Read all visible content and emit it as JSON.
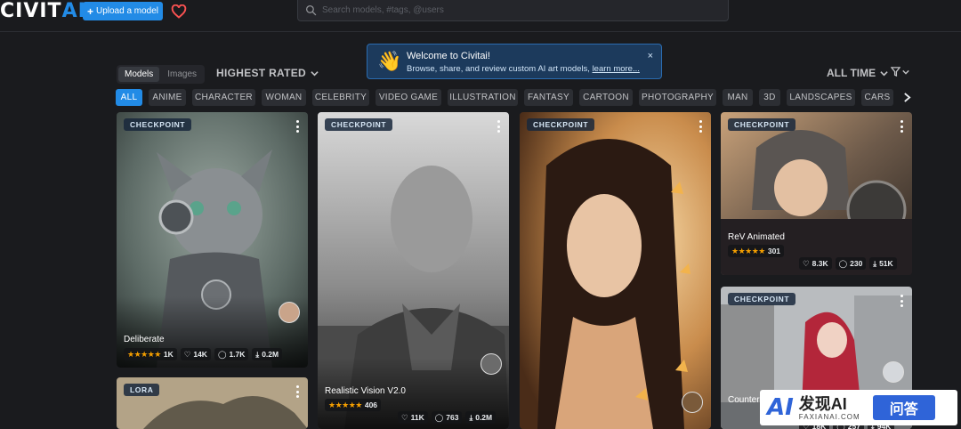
{
  "header": {
    "logo_part1": "CIVIT",
    "logo_part2": "AI",
    "upload_label": "Upload a model",
    "search_placeholder": "Search models, #tags, @users"
  },
  "toast": {
    "title": "Welcome to Civitai!",
    "body": "Browse, share, and review custom AI art models, ",
    "link": "learn more...",
    "close": "×"
  },
  "toolbar": {
    "tab_models": "Models",
    "tab_images": "Images",
    "sort": "HIGHEST RATED",
    "period": "ALL TIME"
  },
  "chips": [
    "ALL",
    "ANIME",
    "CHARACTER",
    "WOMAN",
    "CELEBRITY",
    "VIDEO GAME",
    "ILLUSTRATION",
    "FANTASY",
    "CARTOON",
    "PHOTOGRAPHY",
    "MAN",
    "3D",
    "LANDSCAPES",
    "CARS"
  ],
  "cards": [
    {
      "badge": "CHECKPOINT",
      "title": "Deliberate",
      "reviews": "1K",
      "likes": "14K",
      "comments": "1.7K",
      "downloads": "0.2M"
    },
    {
      "badge": "CHECKPOINT",
      "title": "Realistic Vision V2.0",
      "reviews": "406",
      "likes": "11K",
      "comments": "763",
      "downloads": "0.2M"
    },
    {
      "badge": "CHECKPOINT"
    },
    {
      "badge": "CHECKPOINT",
      "title": "ReV Animated",
      "reviews": "301",
      "likes": "8.3K",
      "comments": "230",
      "downloads": "51K"
    },
    {
      "badge": "CHECKPOINT",
      "title": "Counter",
      "likes": "18K",
      "comments": "257",
      "downloads": "94K"
    },
    {
      "badge": "LORA"
    }
  ],
  "watermark": {
    "cn": "发现AI",
    "en": "FAXIANAI.COM",
    "qa": "问答",
    "mark": "AI"
  },
  "colors": {
    "accent": "#228be6",
    "background": "#1a1b1e",
    "star": "#f59f00",
    "heart": "#fa5252"
  }
}
